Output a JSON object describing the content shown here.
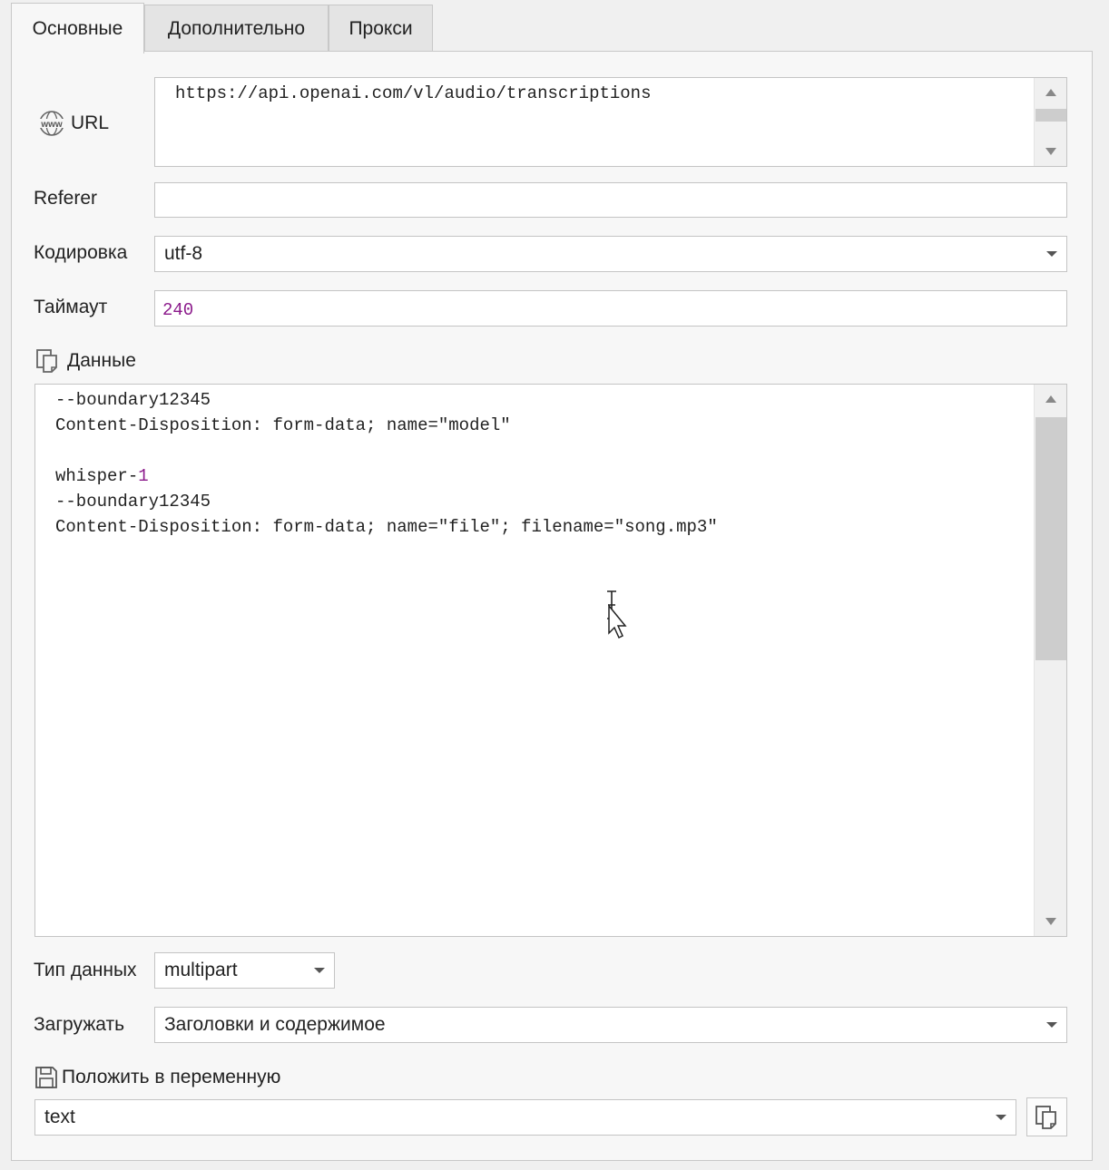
{
  "tabs": [
    {
      "label": "Основные"
    },
    {
      "label": "Дополнительно"
    },
    {
      "label": "Прокси"
    }
  ],
  "url": {
    "label": "URL",
    "value": "https://api.openai.com/vl/audio/transcriptions"
  },
  "referer": {
    "label": "Referer",
    "value": ""
  },
  "encoding": {
    "label": "Кодировка",
    "value": "utf-8"
  },
  "timeout": {
    "label": "Таймаут",
    "value": "240"
  },
  "data": {
    "label": "Данные",
    "lines": [
      {
        "text": "--boundary12345"
      },
      {
        "text": "Content-Disposition: form-data; name=\"model\""
      },
      {
        "text": ""
      },
      {
        "text_pre": "whisper-",
        "text_num": "1"
      },
      {
        "text": "--boundary12345"
      },
      {
        "text": "Content-Disposition: form-data; name=\"file\"; filename=\"song.mp3\""
      }
    ]
  },
  "data_type": {
    "label": "Тип данных",
    "value": "multipart"
  },
  "load": {
    "label": "Загружать",
    "value": "Заголовки и содержимое"
  },
  "save_var": {
    "label": "Положить в переменную",
    "value": "text"
  },
  "icons": {
    "url": "globe-www-icon",
    "data": "copy-pages-icon",
    "save": "floppy-disk-icon",
    "var_action": "copy-pages-icon"
  }
}
